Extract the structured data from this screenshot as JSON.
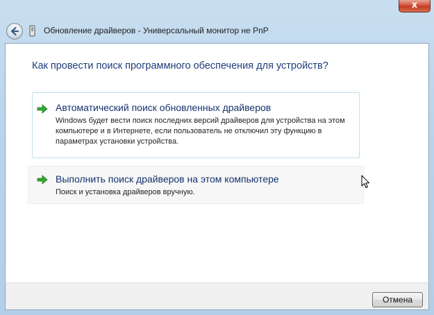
{
  "window": {
    "title": "Обновление драйверов - Универсальный монитор не PnP",
    "close_label": "x"
  },
  "content": {
    "question": "Как провести поиск программного обеспечения для устройств?",
    "options": [
      {
        "title": "Автоматический поиск обновленных драйверов",
        "description": "Windows будет вести поиск последних версий драйверов для устройства на этом компьютере и в Интернете, если пользователь не отключил эту функцию в параметрах установки устройства."
      },
      {
        "title": "Выполнить поиск драйверов на этом компьютере",
        "description": "Поиск и установка драйверов вручную."
      }
    ]
  },
  "footer": {
    "cancel_label": "Отмена"
  },
  "icons": {
    "back": "back-arrow-icon",
    "device": "device-icon",
    "option_arrow": "green-arrow-icon",
    "cursor": "mouse-pointer-icon"
  },
  "colors": {
    "accent_text": "#1f3d7a",
    "option_arrow": "#2f9e2f",
    "close_button": "#c23a22",
    "frame": "#b9d4ec"
  }
}
